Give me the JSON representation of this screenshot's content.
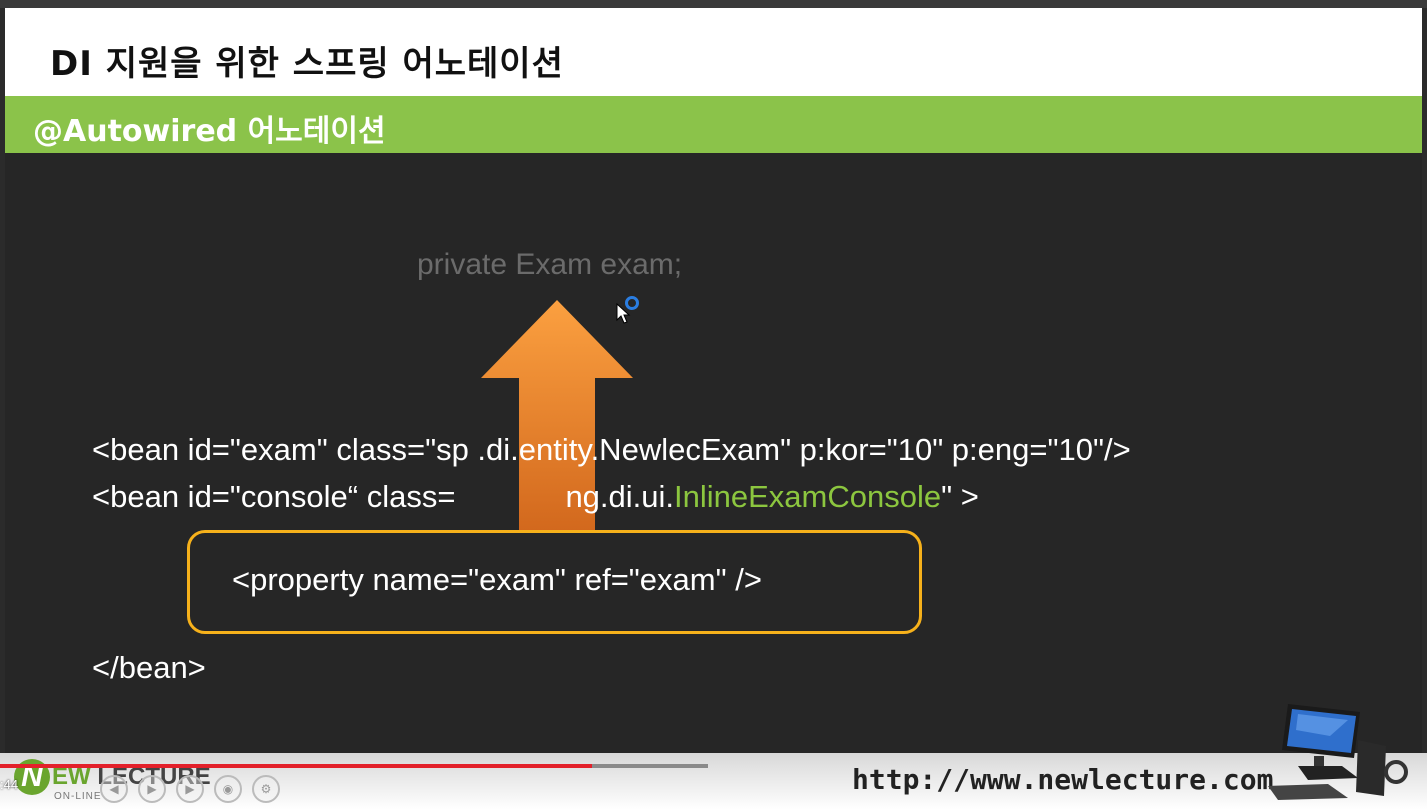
{
  "slide": {
    "title": "DI 지원을 위한 스프링 어노테이션",
    "subtitle": "@Autowired 어노테이션",
    "ghost_code": "private Exam exam;",
    "code_lines": {
      "line1": "<bean id=\"exam\" class=\"sp     .di.entity.NewlecExam\" p:kor=\"10\" p:eng=\"10\"/>",
      "line2_a": "<bean id=\"console“ class=",
      "line2_b": "ng.di.ui.",
      "line2_green": "InlineExamConsole",
      "line2_c": "\" >",
      "line3": "<property name=\"exam\" ref=\"exam\" />",
      "line4": "</bean>"
    },
    "colors": {
      "accent_green": "#8bc34a",
      "arrow_orange": "#f5872a",
      "highlight_box": "#f6b11b",
      "code_green": "#8cc63f"
    }
  },
  "footer": {
    "logo_letter": "N",
    "logo_word_green": "EW",
    "logo_word": "LECTURE",
    "logo_sub": "ON-LINE",
    "url": "http://www.newlecture.com",
    "icon": "computer-desk-icon"
  },
  "player": {
    "time": ":44",
    "progress": 0.415,
    "buffered": 0.496,
    "controls": [
      "prev-icon",
      "play-icon",
      "next-icon",
      "volume-icon",
      "settings-icon",
      "more-icon"
    ]
  }
}
